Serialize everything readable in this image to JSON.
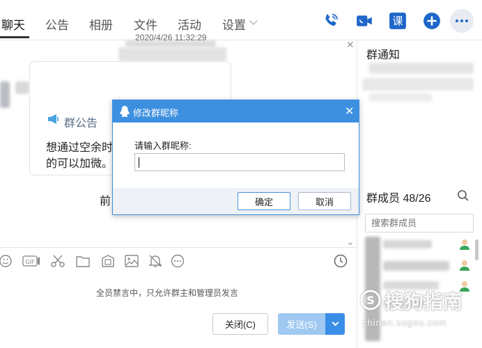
{
  "nav": {
    "tabs": [
      {
        "label": "聊天"
      },
      {
        "label": "公告"
      },
      {
        "label": "相册"
      },
      {
        "label": "文件"
      },
      {
        "label": "活动"
      },
      {
        "label": "设置"
      }
    ],
    "active_tab": "聊天",
    "icons": [
      "phone-icon",
      "video-call-icon",
      "class-icon",
      "add-circle-icon",
      "more-icon"
    ],
    "accent_color": "#1e66c9"
  },
  "chat": {
    "timestamp": "2020/4/26 11:32:29",
    "announcement": {
      "title": "群公告",
      "line1": "想通过空余时",
      "line2": "的可以加微。",
      "more_label": "前"
    }
  },
  "toolbar": {
    "icons": [
      "emoji-icon",
      "gif-icon",
      "scissors-icon",
      "folder-icon",
      "image-gallery-icon",
      "image-icon",
      "bell-off-icon",
      "more-circle-icon",
      "history-icon"
    ]
  },
  "composer": {
    "muted_notice": "全员禁言中，只允许群主和管理员发言",
    "close_label": "关闭(C)",
    "send_label": "发送(S)"
  },
  "right_panel": {
    "notice_title": "群通知",
    "members_title": "群成员 48/26",
    "member_search_placeholder": "搜索群成员"
  },
  "dialog": {
    "title": "修改群昵称",
    "prompt": "请输入群昵称:",
    "input_value": "",
    "ok_label": "确定",
    "cancel_label": "取消",
    "header_color": "#3d8fe0"
  },
  "watermark": {
    "brand": "搜狗指南",
    "url": "zhinan.sogou.com"
  }
}
